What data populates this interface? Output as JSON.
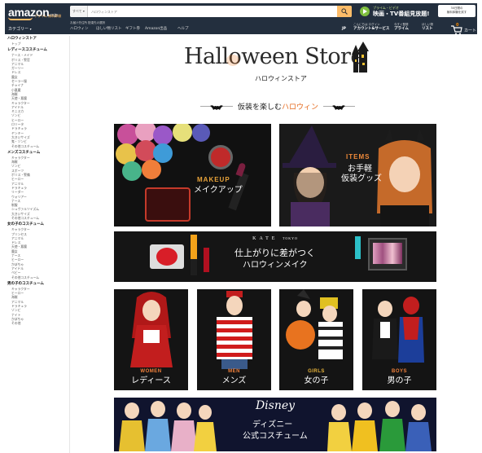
{
  "header": {
    "logo": "amazon",
    "logo_suffix": ".co.jp",
    "logo_sub": "プライム 無料体験",
    "search_dropdown": "すべて",
    "search_placeholder": "ハロウィンストア",
    "prime_line1": "プライム・ビデオ",
    "prime_line2": "映画・TV番組見放題!",
    "trial_line1": "30日間の",
    "trial_line2": "無料体験を試す",
    "category_menu": "カテゴリー",
    "deliver_to": "お届け先住所 配達先の選択",
    "nav_links": [
      "ハロウィン",
      "ほしい物リスト",
      "ギフト券",
      "Amazon出品",
      "ヘルプ"
    ],
    "lang": "JP",
    "account_line1": "こんにちは ログイン",
    "account_line2": "アカウント&サービス",
    "prime_nav_line1": "今すぐ登録",
    "prime_nav_line2": "プライム",
    "list_line1": "ほしい物",
    "list_line2": "リスト",
    "cart_count": "0",
    "cart_label": "カート"
  },
  "sidebar": {
    "sections": [
      {
        "title": "ハロウィンストア",
        "items": [
          "トップ"
        ]
      },
      {
        "title": "レディースコスチューム",
        "items": [
          "ナース・メイド",
          "ポリス・警官",
          "アニマル",
          "ガーリー",
          "ドレス",
          "魔女",
          "セーラー服",
          "チャイナ",
          "小悪魔",
          "海賊",
          "天使・悪魔",
          "キャラクター",
          "アイドル",
          "ミニスカ",
          "ゾンビ",
          "ヒーロー",
          "ロリータ",
          "ドラキュラ",
          "ヤンキー",
          "大きいサイズ",
          "鬼・ゾンビ",
          "その他コスチューム"
        ]
      },
      {
        "title": "メンズコスチューム",
        "items": [
          "キャラクター",
          "海賊",
          "ゾンビ",
          "スポーツ",
          "ポリス・警備",
          "ヒーロー",
          "アニマル",
          "ドラキュラ",
          "リーダー",
          "ウォリアー",
          "ナース",
          "制服",
          "シュヴァルツイズム",
          "大きいサイズ",
          "その他コスチューム"
        ]
      },
      {
        "title": "女の子のコスチューム",
        "items": [
          "キャラクター",
          "プリンセス",
          "アニマル",
          "ドレス",
          "天使・悪魔",
          "魔女",
          "ナース",
          "ヒーロー",
          "かぼちゃ",
          "アイドル",
          "ベビー",
          "その他コスチューム"
        ]
      },
      {
        "title": "男の子のコスチューム",
        "items": [
          "キャラクター",
          "ヒーロー",
          "海賊",
          "アニマル",
          "ドラキュラ",
          "ゾンビ",
          "ナイト",
          "かぼちゃ",
          "その他"
        ]
      }
    ]
  },
  "main": {
    "store_title": "Halloween Store",
    "store_sub": "ハロウィンストア",
    "tagline_pre": "仮装を楽しむ",
    "tagline_hl": "ハロウィン",
    "makeup_en": "MAKEUP",
    "makeup_jp": "メイクアップ",
    "items_en": "ITEMS",
    "items_jp1": "お手軽",
    "items_jp2": "仮装グッズ",
    "kate_brand": "KATE",
    "kate_sub": "TOKYO",
    "kate_jp1": "仕上がりに差がつく",
    "kate_jp2": "ハロウィンメイク",
    "categories": [
      {
        "en": "WOMEN",
        "jp": "レディース",
        "color": "#f0803c"
      },
      {
        "en": "MEN",
        "jp": "メンズ",
        "color": "#f0803c"
      },
      {
        "en": "GIRLS",
        "jp": "女の子",
        "color": "#e8b43a"
      },
      {
        "en": "BOYS",
        "jp": "男の子",
        "color": "#f0803c"
      }
    ],
    "disney_logo": "Disney",
    "disney_jp1": "ディズニー",
    "disney_jp2": "公式コスチューム"
  }
}
